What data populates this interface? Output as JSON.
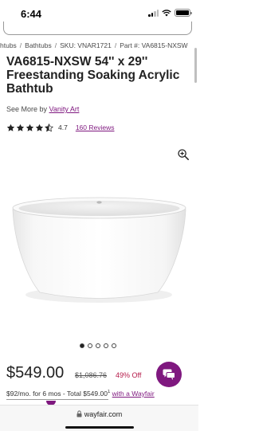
{
  "status_bar": {
    "time": "6:44"
  },
  "breadcrumb": {
    "items": [
      "htubs",
      "Bathtubs",
      "SKU: VNAR1721",
      "Part #: VA6815-NXSW"
    ]
  },
  "product": {
    "title": "VA6815-NXSW 54'' x 29'' Freestanding Soaking Acrylic Bathtub",
    "see_more_prefix": "See More by",
    "brand": "Vanity Art",
    "rating_value": "4.7",
    "stars": 4.7,
    "reviews_label": "160 Reviews"
  },
  "carousel": {
    "total": 5,
    "active": 0
  },
  "pricing": {
    "price": "$549.00",
    "was_price": "$1,086.76",
    "discount": "49% Off"
  },
  "financing": {
    "text": "$92/mo. for 6 mos - Total $549.00",
    "footnote": "1",
    "link": "with a Wayfair"
  },
  "browser": {
    "url": "wayfair.com"
  },
  "colors": {
    "brand": "#7f187f",
    "discount": "#b51b4a"
  }
}
